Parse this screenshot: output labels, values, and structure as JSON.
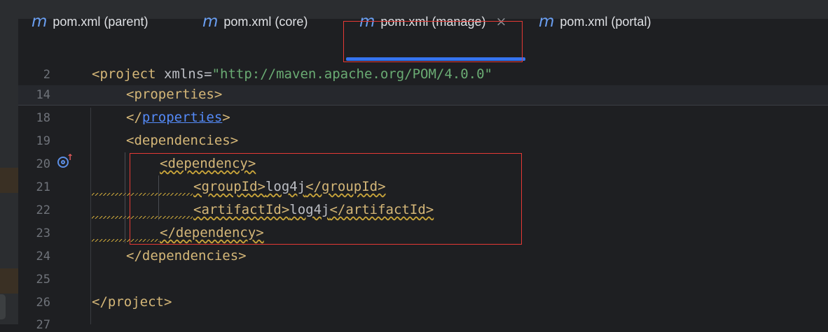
{
  "tabs": [
    {
      "label": "pom.xml (parent)",
      "icon": "maven-m-icon",
      "glyph": "m",
      "active": false
    },
    {
      "label": "pom.xml (core)",
      "icon": "maven-m-icon",
      "glyph": "m",
      "active": false
    },
    {
      "label": "pom.xml (manage)",
      "icon": "maven-m-icon",
      "glyph": "m",
      "active": true,
      "close": "×"
    },
    {
      "label": "pom.xml (portal)",
      "icon": "maven-m-icon",
      "glyph": "m",
      "active": false
    }
  ],
  "editor": {
    "line_numbers": [
      "2",
      "14",
      "18",
      "19",
      "20",
      "21",
      "22",
      "23",
      "24",
      "25",
      "26",
      "27"
    ],
    "lines": {
      "l2": {
        "open": "<project",
        "attr": " xmlns",
        "eq": "=",
        "value": "\"http://maven.apache.org/POM/4.0.0\""
      },
      "l14": {
        "text": "<properties>"
      },
      "l18": {
        "open": "</",
        "name": "properties",
        "close": ">"
      },
      "l19": {
        "text": "<dependencies>"
      },
      "l20": {
        "text": "<dependency>"
      },
      "l21": {
        "open": "<groupId>",
        "value": "log4j",
        "close": "</groupId>"
      },
      "l22": {
        "open": "<artifactId>",
        "value": "log4j",
        "close": "</artifactId>"
      },
      "l23": {
        "text": "</dependency>"
      },
      "l24": {
        "text": "</dependencies>"
      },
      "l26": {
        "text": "</project>"
      }
    },
    "gutter_icon": "run-target-icon",
    "colors": {
      "tag": "#d5b778",
      "string": "#6aab73",
      "link": "#548af7",
      "accent": "#3574f0",
      "highlight_border": "#e53935"
    }
  }
}
